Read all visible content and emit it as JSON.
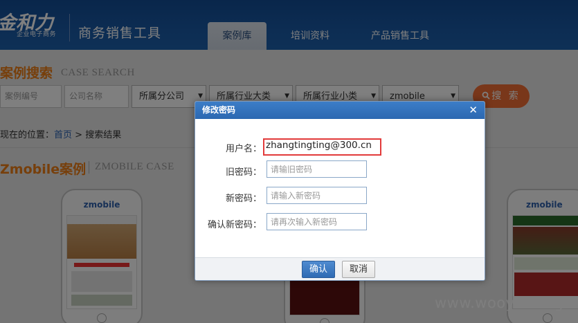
{
  "header": {
    "logo_text": "金和力",
    "logo_sub": "企业电子商务",
    "app_title": "商务销售工具",
    "tabs": [
      {
        "label": "案例库",
        "active": true
      },
      {
        "label": "培训资料",
        "active": false
      },
      {
        "label": "产品销售工具",
        "active": false
      }
    ]
  },
  "search": {
    "title": "案例搜索",
    "subtitle": "CASE SEARCH",
    "case_no_placeholder": "案例编号",
    "company_placeholder": "公司名称",
    "branch_select": "所属分公司",
    "industry_major_select": "所属行业大类",
    "industry_minor_select": "所属行业小类",
    "product_select": "zmobile",
    "search_button": "搜 索"
  },
  "breadcrumb": {
    "prefix": "现在的位置：",
    "home": "首页",
    "separator": ">",
    "current": "搜索结果"
  },
  "cases": {
    "title": "Zmobile案例",
    "subtitle": "ZMOBILE CASE",
    "phone_logo": "zmobile"
  },
  "watermark": "www.wooyun.org",
  "modal": {
    "title": "修改密码",
    "close_glyph": "✕",
    "username_label": "用户名：",
    "username_value": "zhangtingting@300.cn",
    "old_password_label": "旧密码：",
    "old_password_placeholder": "请输旧密码",
    "new_password_label": "新密码：",
    "new_password_placeholder": "请输入新密码",
    "confirm_password_label": "确认新密码：",
    "confirm_password_placeholder": "请再次输入新密码",
    "ok_button": "确认",
    "cancel_button": "取消"
  },
  "colors": {
    "header_bg": "#1a5aa6",
    "accent_orange": "#ee7f17",
    "search_button": "#f26f35",
    "highlight_red": "#e23a3a"
  }
}
